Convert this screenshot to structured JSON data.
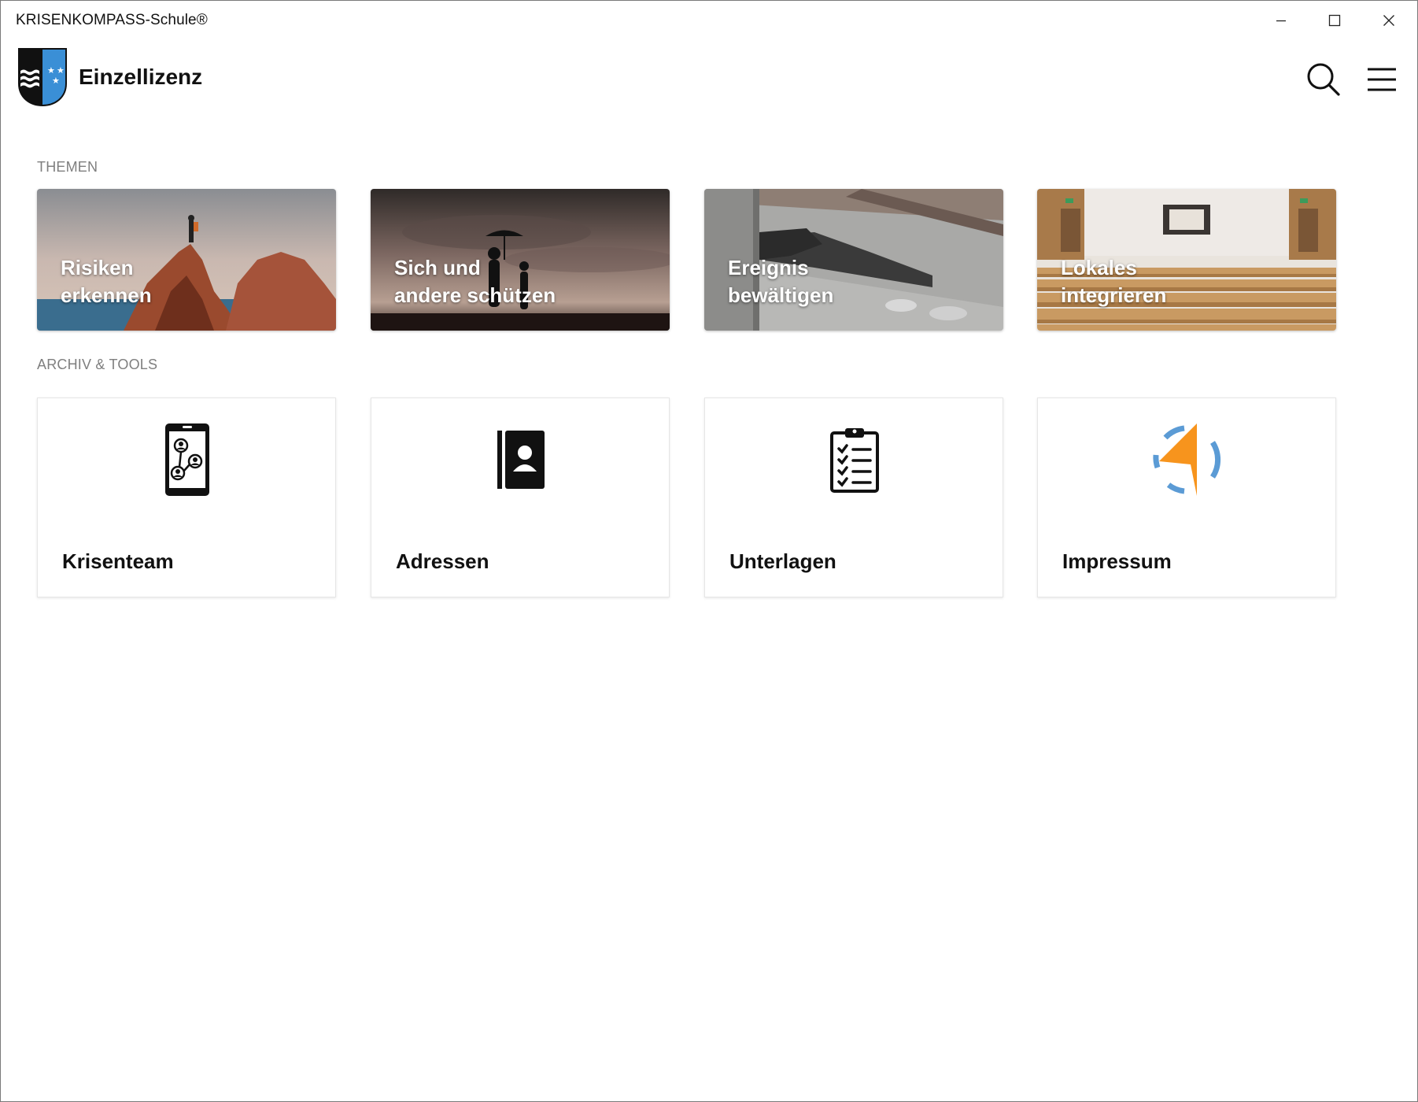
{
  "window": {
    "title": "KRISENKOMPASS-Schule®",
    "controls": [
      "minimize-icon",
      "maximize-icon",
      "close-icon"
    ]
  },
  "header": {
    "logo": "canton-coat-of-arms",
    "license_label": "Einzellizenz",
    "icons": [
      "search-icon",
      "menu-icon"
    ]
  },
  "sections": {
    "themes_label": "THEMEN",
    "tools_label": "ARCHIV & TOOLS"
  },
  "themes": [
    {
      "line1": "Risiken",
      "line2": "erkennen"
    },
    {
      "line1": "Sich und",
      "line2": "andere schützen"
    },
    {
      "line1": "Ereignis",
      "line2": "bewältigen"
    },
    {
      "line1": "Lokales",
      "line2": "integrieren"
    }
  ],
  "tools": [
    {
      "label": "Krisenteam",
      "icon": "team-network-phone-icon"
    },
    {
      "label": "Adressen",
      "icon": "address-book-icon"
    },
    {
      "label": "Unterlagen",
      "icon": "clipboard-checklist-icon"
    },
    {
      "label": "Impressum",
      "icon": "compass-arrow-icon"
    }
  ],
  "colors": {
    "section_label": "#7f7f7f",
    "logo_blue": "#3a8fd6",
    "logo_black": "#111111",
    "compass_orange": "#f7941d",
    "compass_blue": "#5b9bd5"
  }
}
